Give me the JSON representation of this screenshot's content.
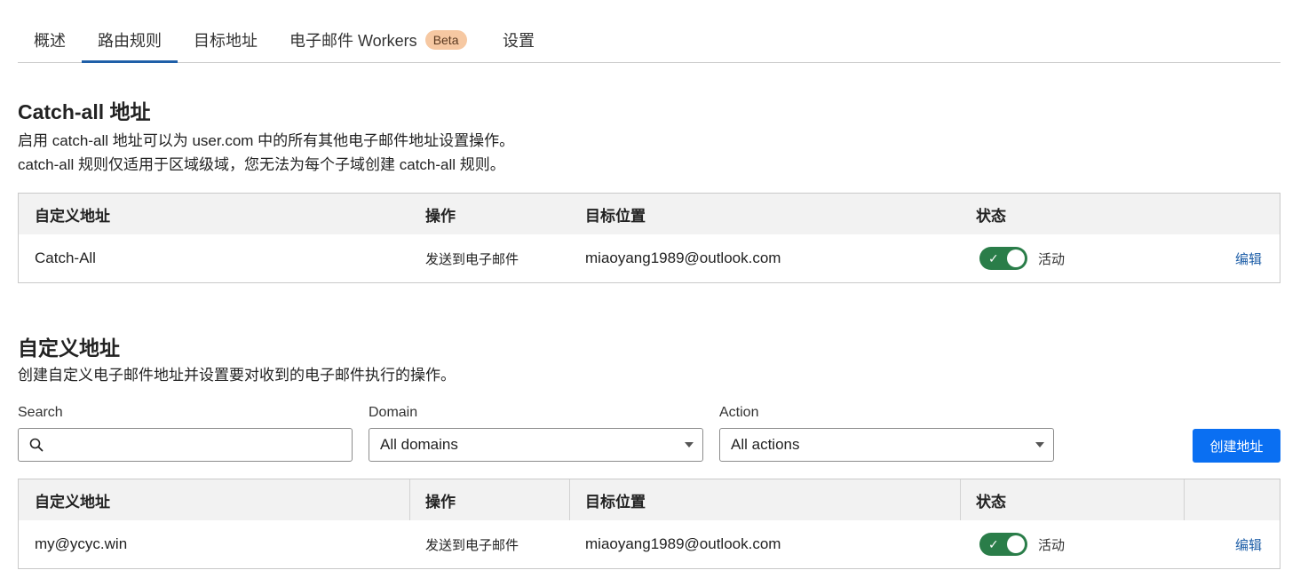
{
  "tabs": [
    {
      "label": "概述",
      "active": false
    },
    {
      "label": "路由规则",
      "active": true
    },
    {
      "label": "目标地址",
      "active": false
    },
    {
      "label": "电子邮件 Workers",
      "active": false,
      "badge": "Beta"
    },
    {
      "label": "设置",
      "active": false
    }
  ],
  "catchall": {
    "title": "Catch-all 地址",
    "desc_line1": "启用 catch-all 地址可以为 user.com 中的所有其他电子邮件地址设置操作。",
    "desc_line2": "catch-all 规则仅适用于区域级域，您无法为每个子域创建 catch-all 规则。",
    "headers": {
      "address": "自定义地址",
      "action": "操作",
      "destination": "目标位置",
      "status": "状态"
    },
    "row": {
      "address": "Catch-All",
      "action": "发送到电子邮件",
      "destination": "miaoyang1989@outlook.com",
      "status": "活动",
      "enabled": true,
      "edit": "编辑"
    }
  },
  "custom": {
    "title": "自定义地址",
    "desc": "创建自定义电子邮件地址并设置要对收到的电子邮件执行的操作。",
    "filters": {
      "search_label": "Search",
      "search_value": "",
      "domain_label": "Domain",
      "domain_value": "All domains",
      "action_label": "Action",
      "action_value": "All actions"
    },
    "create_button": "创建地址",
    "headers": {
      "address": "自定义地址",
      "action": "操作",
      "destination": "目标位置",
      "status": "状态"
    },
    "rows": [
      {
        "address": "my@ycyc.win",
        "action": "发送到电子邮件",
        "destination": "miaoyang1989@outlook.com",
        "status": "活动",
        "enabled": true,
        "edit": "编辑"
      }
    ]
  },
  "colors": {
    "accent": "#1f5fa8",
    "toggle_on": "#2a7d49",
    "primary_button": "#0a6ff2",
    "badge_bg": "#f6c8a2"
  }
}
